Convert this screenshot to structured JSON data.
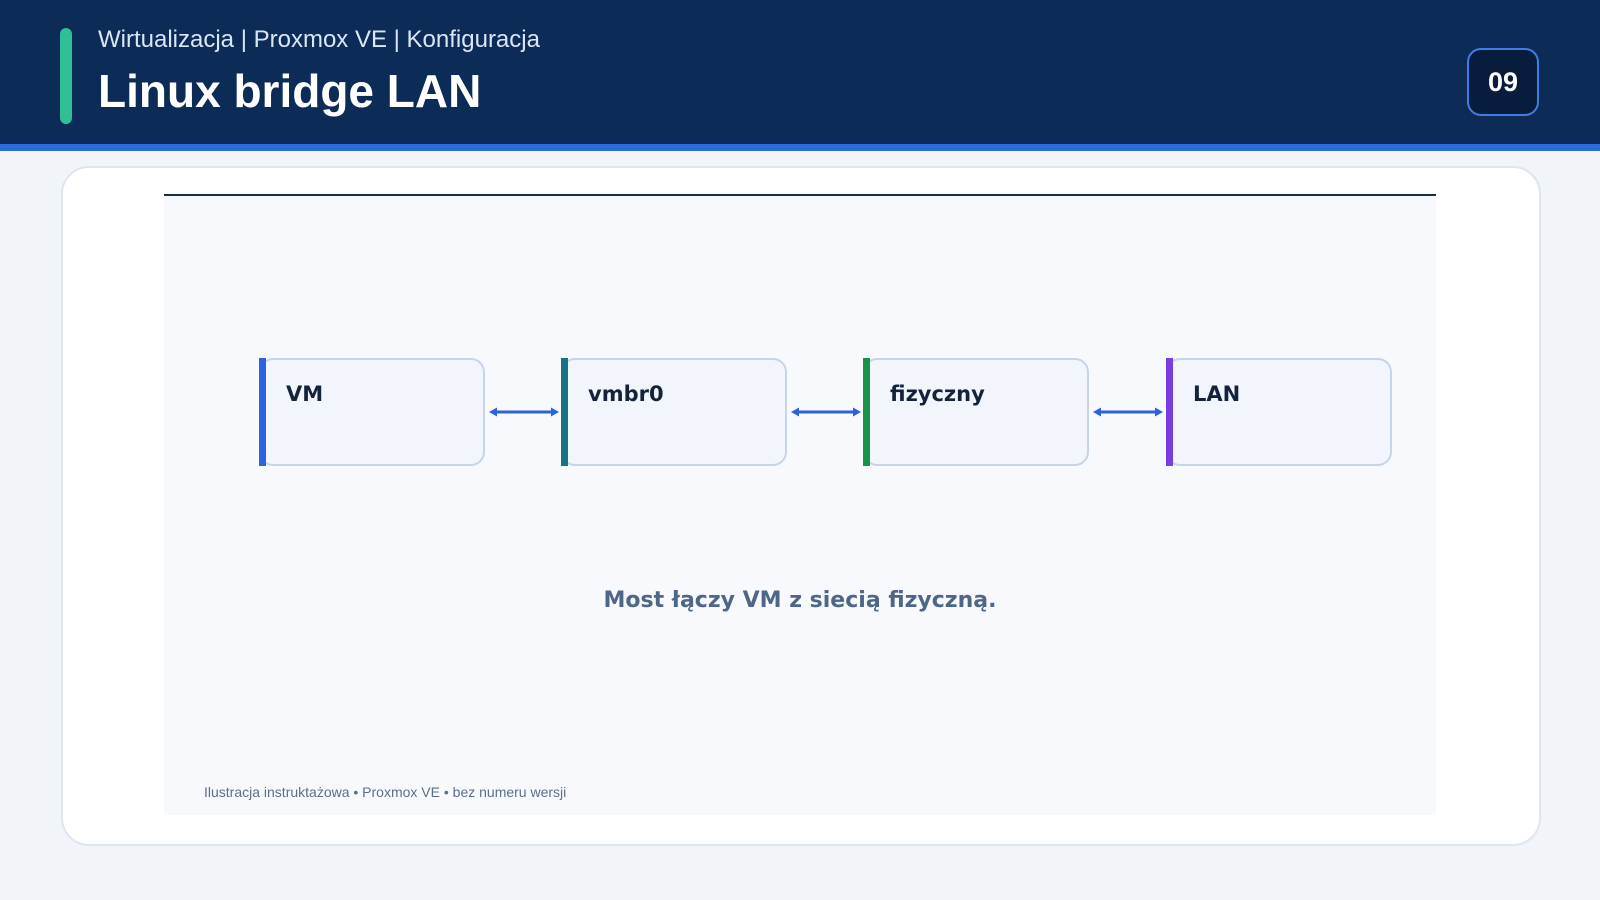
{
  "header": {
    "breadcrumb": "Wirtualizacja | Proxmox VE | Konfiguracja",
    "title": "Linux bridge LAN",
    "page_number": "09"
  },
  "diagram": {
    "nodes": [
      {
        "label": "VM",
        "accent_color": "#2d62e0"
      },
      {
        "label": "vmbr0",
        "accent_color": "#14738b"
      },
      {
        "label": "fizyczny",
        "accent_color": "#169447"
      },
      {
        "label": "LAN",
        "accent_color": "#7a3be0"
      }
    ],
    "connector_color": "#2a62dc",
    "caption": "Most łączy VM z siecią fizyczną.",
    "footnote": "Ilustracja instruktażowa • Proxmox VE • bez numeru wersji"
  },
  "colors": {
    "header_background": "#0c2b57",
    "header_stripe": "#2a6ddd",
    "header_accent": "#30bf97"
  }
}
